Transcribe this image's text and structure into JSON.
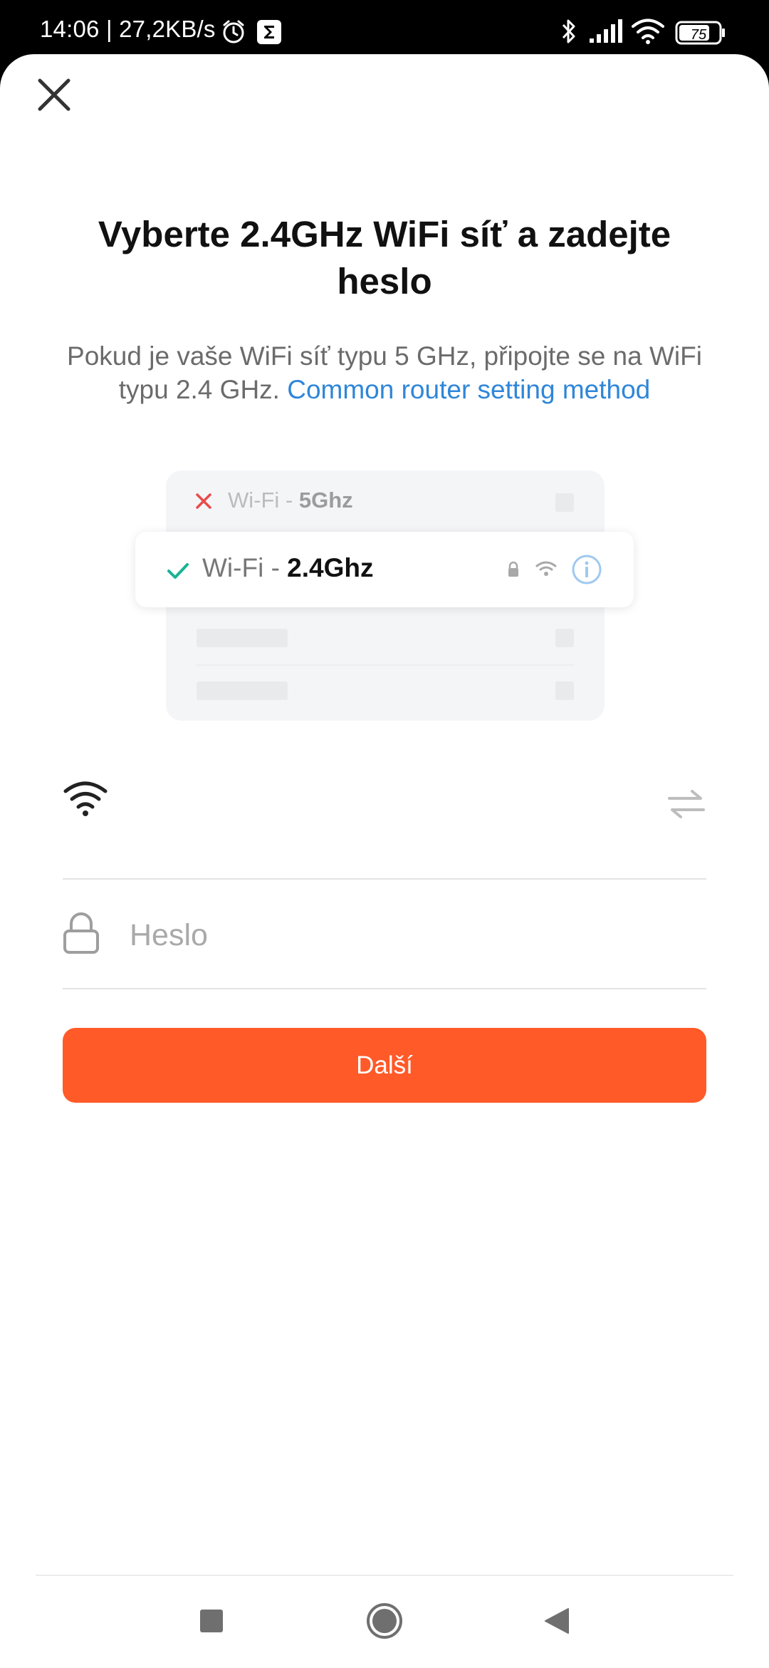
{
  "status_bar": {
    "time_speed": "14:06 | 27,2KB/s",
    "battery": "75"
  },
  "title": "Vyberte 2.4GHz WiFi síť a zadejte heslo",
  "subtitle": {
    "text": "Pokud je vaše WiFi síť typu 5 GHz, připojte se na WiFi typu 2.4 GHz. ",
    "link": "Common router setting method"
  },
  "illustration": {
    "row_5g_prefix": "Wi-Fi - ",
    "row_5g_band": "5Ghz",
    "row_24g_prefix": "Wi-Fi - ",
    "row_24g_band": "2.4Ghz"
  },
  "wifi_field": {
    "value": ""
  },
  "password_field": {
    "placeholder": "Heslo",
    "value": ""
  },
  "next_button": {
    "label": "Další"
  },
  "colors": {
    "accent": "#ff5a28",
    "link": "#2f86d8",
    "check_green": "#1ab394",
    "cross_red": "#e84b4b",
    "info_blue": "#9fc9f0"
  },
  "icons": [
    "close-icon",
    "wifi-icon",
    "switch-network-icon",
    "lock-icon",
    "recents-icon",
    "home-icon",
    "back-icon"
  ]
}
